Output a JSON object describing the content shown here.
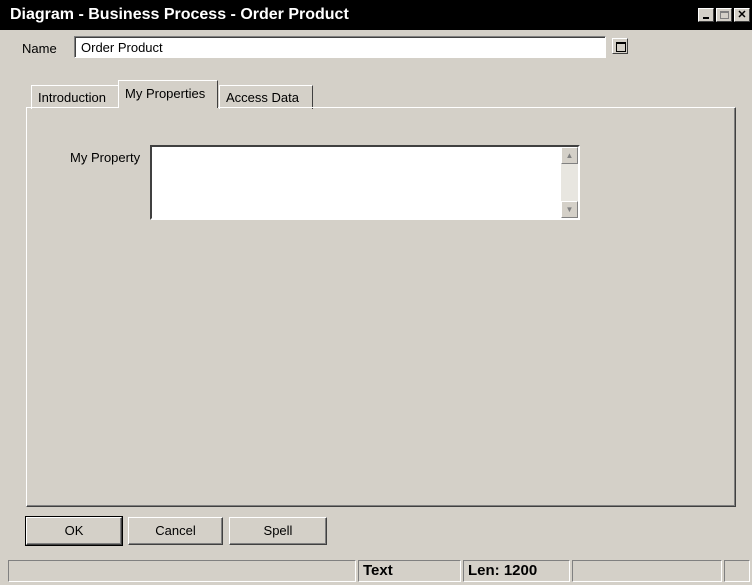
{
  "window": {
    "title": "Diagram - Business Process - Order Product"
  },
  "name_field": {
    "label": "Name",
    "value": "Order Product"
  },
  "tabs": [
    {
      "label": "Introduction",
      "active": false
    },
    {
      "label": "My Properties",
      "active": true
    },
    {
      "label": "Access Data",
      "active": false
    }
  ],
  "properties": {
    "my_property_label": "My Property",
    "my_property_value": ""
  },
  "buttons": {
    "ok": "OK",
    "cancel": "Cancel",
    "spell": "Spell"
  },
  "status_bar": {
    "cells": [
      "",
      "",
      "Text",
      "Len: 1200",
      "",
      ""
    ]
  },
  "icons": {
    "minimize": "minimize-icon",
    "maximize": "maximize-icon",
    "close": "close-icon",
    "expand": "expand-field-icon",
    "scroll_up": "scroll-up-arrow-icon",
    "scroll_down": "scroll-down-arrow-icon"
  }
}
